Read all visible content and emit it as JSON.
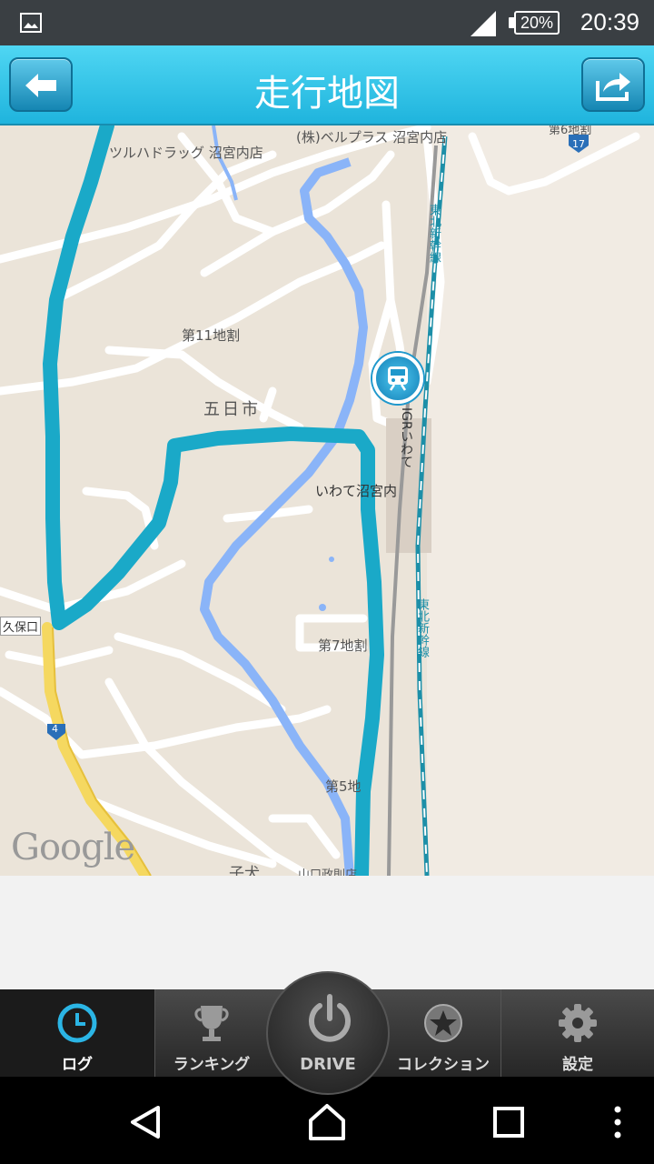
{
  "status_bar": {
    "battery_label": "20%",
    "time": "20:39"
  },
  "header": {
    "title": "走行地図",
    "back_icon": "arrow-left-icon",
    "share_icon": "share-arrow-icon"
  },
  "map": {
    "labels": {
      "drugstore": "ツルハドラッグ 沼宮内店",
      "bellplus": "(株)ベルプラス 沼宮内店",
      "district6": "第6地割",
      "route17": "17",
      "tohoku_shinkansen_top": "東北新幹線",
      "district11": "第11地割",
      "itsukaichi": "五日市",
      "igr_line": "IGRいわて",
      "station": "いわて沼宮内",
      "kubo": "久保口",
      "district7": "第7地割",
      "tohoku_shinkansen_bottom": "東北新幹線",
      "route4": "4",
      "district5": "第5地",
      "koinu": "子犬",
      "yamaguchi": "山口政則店"
    },
    "google_logo": "Google",
    "route_color": "#1aa9c8",
    "water_color": "#8ab4f8",
    "station_marker_icon": "train-icon"
  },
  "tabs": [
    {
      "label": "ログ",
      "icon": "clock-icon",
      "active": true
    },
    {
      "label": "ランキング",
      "icon": "trophy-icon",
      "active": false
    },
    {
      "label": "DRIVE",
      "icon": "power-icon",
      "active": false
    },
    {
      "label": "コレクション",
      "icon": "star-icon",
      "active": false
    },
    {
      "label": "設定",
      "icon": "gear-icon",
      "active": false
    }
  ],
  "nav_bar": {
    "back_icon": "triangle-back-icon",
    "home_icon": "home-icon",
    "recents_icon": "square-recents-icon",
    "menu_icon": "dots-menu-icon"
  }
}
